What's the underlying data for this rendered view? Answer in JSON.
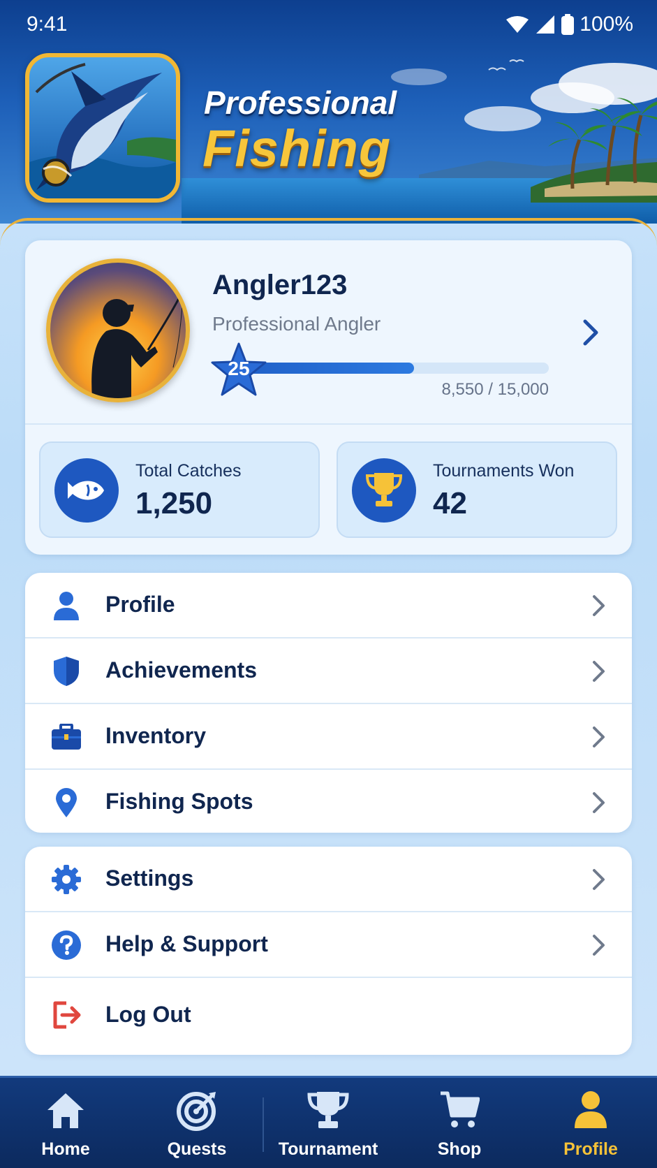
{
  "status_bar": {
    "time": "9:41",
    "battery": "100%"
  },
  "header": {
    "title_line1": "Professional",
    "title_line2": "Fishing"
  },
  "profile": {
    "username": "Angler123",
    "rank": "Professional Angler",
    "level": "25",
    "xp_text": "8,550 / 15,000",
    "xp_fraction": 0.57
  },
  "stats": [
    {
      "label": "Total Catches",
      "value": "1,250",
      "icon": "fish-icon"
    },
    {
      "label": "Tournaments Won",
      "value": "42",
      "icon": "trophy-icon"
    }
  ],
  "menu_primary": [
    {
      "label": "Profile",
      "icon": "person-icon"
    },
    {
      "label": "Achievements",
      "icon": "shield-icon"
    },
    {
      "label": "Inventory",
      "icon": "toolbox-icon"
    },
    {
      "label": "Fishing Spots",
      "icon": "location-pin-icon"
    }
  ],
  "menu_secondary": [
    {
      "label": "Settings",
      "icon": "gear-icon"
    },
    {
      "label": "Help & Support",
      "icon": "help-icon"
    },
    {
      "label": "Log Out",
      "icon": "logout-icon"
    }
  ],
  "bottom_nav": [
    {
      "label": "Home",
      "icon": "home-icon"
    },
    {
      "label": "Quests",
      "icon": "target-icon"
    },
    {
      "label": "Tournament",
      "icon": "trophy-icon"
    },
    {
      "label": "Shop",
      "icon": "cart-icon"
    },
    {
      "label": "Profile",
      "icon": "person-icon",
      "active": true
    }
  ],
  "colors": {
    "accent": "#1e58c0",
    "gold": "#f6c238",
    "nav_bg": "#0c2a5e",
    "logout": "#e0473e"
  }
}
